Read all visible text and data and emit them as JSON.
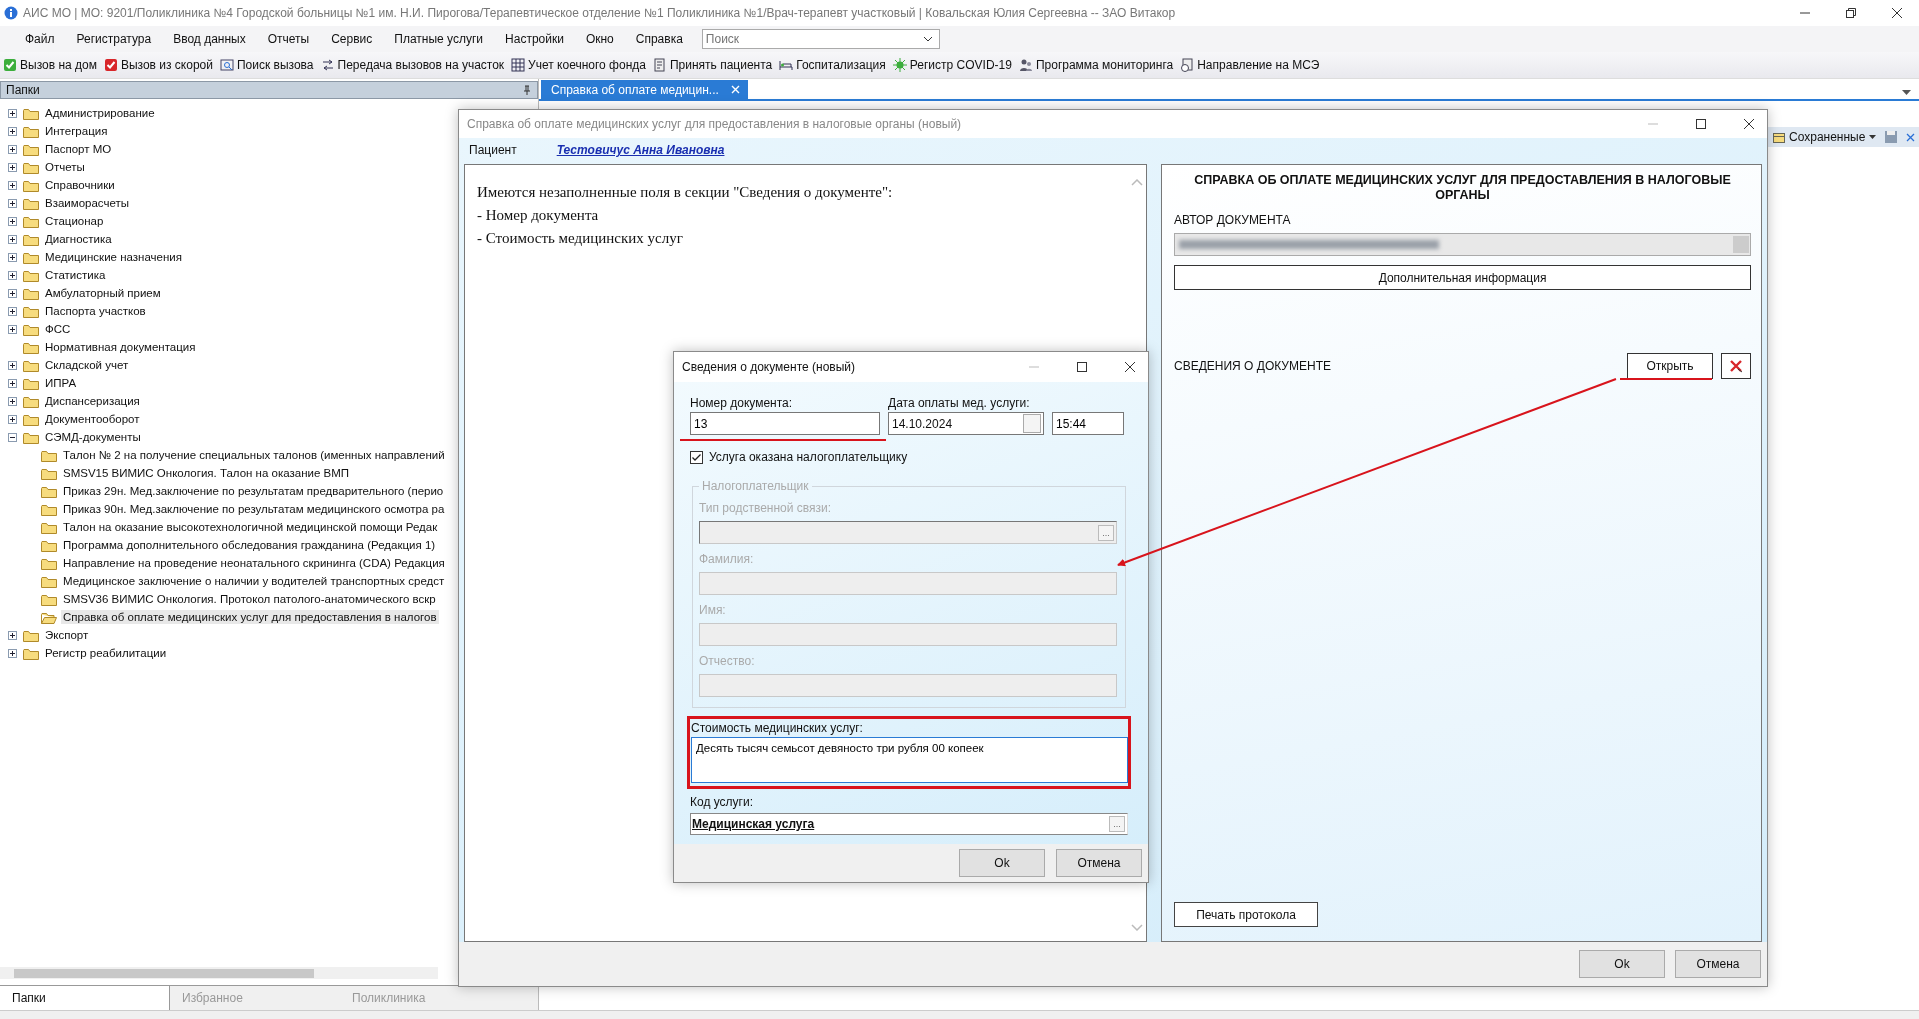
{
  "window": {
    "title": "АИС МО | МО: 9201/Поликлиника №4 Городской больницы №1 им. Н.И. Пирогова/Терапевтическое отделение №1 Поликлиника №1/Врач-терапевт участковый | Ковальская Юлия Сергеевна -- ЗАО Витакор"
  },
  "menu": [
    "Файл",
    "Регистратура",
    "Ввод данных",
    "Отчеты",
    "Сервис",
    "Платные услуги",
    "Настройки",
    "Окно",
    "Справка"
  ],
  "search": {
    "placeholder": "Поиск"
  },
  "toolbar": [
    "Вызов на дом",
    "Вызов из скорой",
    "Поиск вызова",
    "Передача вызовов на участок",
    "Учет коечного фонда",
    "Принять пациента",
    "Госпитализация",
    "Регистр COVID-19",
    "Программа мониторинга",
    "Направление на МСЭ"
  ],
  "folders_panel": {
    "title": "Папки",
    "tree": [
      {
        "label": "Администрирование",
        "expanded": false,
        "selected": false
      },
      {
        "label": "Интеграция",
        "expanded": false,
        "selected": false
      },
      {
        "label": "Паспорт МО",
        "expanded": false,
        "selected": false
      },
      {
        "label": "Отчеты",
        "expanded": false,
        "selected": false
      },
      {
        "label": "Справочники",
        "expanded": false,
        "selected": false
      },
      {
        "label": "Взаиморасчеты",
        "expanded": false,
        "selected": false
      },
      {
        "label": "Стационар",
        "expanded": false,
        "selected": false
      },
      {
        "label": "Диагностика",
        "expanded": false,
        "selected": false
      },
      {
        "label": "Медицинские назначения",
        "expanded": false,
        "selected": false
      },
      {
        "label": "Статистика",
        "expanded": false,
        "selected": false
      },
      {
        "label": "Амбулаторный прием",
        "expanded": false,
        "selected": false
      },
      {
        "label": "Паспорта участков",
        "expanded": false,
        "selected": false
      },
      {
        "label": "ФСС",
        "expanded": false,
        "selected": false
      },
      {
        "label": "Нормативная документация",
        "selected": false
      },
      {
        "label": "Складской учет",
        "expanded": false,
        "selected": false
      },
      {
        "label": "ИПРА",
        "expanded": false,
        "selected": false
      },
      {
        "label": "Диспансеризация",
        "expanded": false,
        "selected": false
      },
      {
        "label": "Документооборот",
        "expanded": false,
        "selected": false
      },
      {
        "label": "СЭМД-документы",
        "expanded": true,
        "selected": false,
        "children": [
          {
            "label": "Талон № 2 на получение специальных талонов (именных направлений",
            "selected": false
          },
          {
            "label": "SMSV15 ВИМИС Онкология. Талон на оказание ВМП",
            "selected": false
          },
          {
            "label": "Приказ 29н. Мед.заключение по результатам предварительного (перио",
            "selected": false
          },
          {
            "label": "Приказ 90н. Мед.заключение по результатам медицинского осмотра ра",
            "selected": false
          },
          {
            "label": "Талон на оказание высокотехнологичной медицинской помощи Редак",
            "selected": false
          },
          {
            "label": "Программа дополнительного обследования гражданина (Редакция 1)",
            "selected": false
          },
          {
            "label": "Направление на проведение неонатального скрининга (CDA) Редакция",
            "selected": false
          },
          {
            "label": "Медицинское заключение о наличии у водителей транспортных средст",
            "selected": false
          },
          {
            "label": "SMSV36 ВИМИС Онкология. Протокол патолого-анатомического вскр",
            "selected": false
          },
          {
            "label": "Справка об оплате медицинских услуг для предоставления в налогов",
            "selected": true
          }
        ]
      },
      {
        "label": "Экспорт",
        "expanded": false,
        "selected": false
      },
      {
        "label": "Регистр реабилитации",
        "expanded": false,
        "selected": false
      }
    ],
    "tabs": [
      {
        "label": "Папки",
        "selected": true
      },
      {
        "label": "Избранное",
        "selected": false
      },
      {
        "label": "Поликлиника",
        "selected": false
      }
    ]
  },
  "document_tabs": [
    {
      "label": "Справка об оплате медицин...",
      "selected": true
    }
  ],
  "saved_toolbar": {
    "label": "Сохраненные"
  },
  "main_dialog": {
    "title": "Справка об оплате медицинских услуг для предоставления в налоговые органы (новый)",
    "patient_label": "Пациент",
    "patient_name": "Тестовичус Анна Ивановна",
    "message": [
      "Имеются незаполненные поля в секции \"Сведения о документе\":",
      "- Номер документа",
      "- Стоимость медицинских услуг"
    ],
    "right_panel": {
      "heading": "СПРАВКА ОБ ОПЛАТЕ МЕДИЦИНСКИХ УСЛУГ ДЛЯ ПРЕДОСТАВЛЕНИЯ В НАЛОГОВЫЕ ОРГАНЫ",
      "author_label": "АВТОР ДОКУМЕНТА",
      "more_info_button": "Дополнительная информация",
      "section_label": "СВЕДЕНИЯ О ДОКУМЕНТЕ",
      "open_button": "Открыть",
      "print_button": "Печать протокола"
    },
    "buttons": [
      "Ok",
      "Отмена"
    ]
  },
  "sub_dialog": {
    "title": "Сведения о документе (новый)",
    "number": {
      "label": "Номер документа:",
      "value": "13"
    },
    "date": {
      "label": "Дата оплаты мед. услуги:",
      "value": "14.10.2024",
      "time": "15:44"
    },
    "taxpayer_checkbox": {
      "label": "Услуга оказана налогоплательщику",
      "checked": true
    },
    "taxpayer_group": {
      "title": "Налогоплательщик",
      "disabled": true,
      "fields": [
        {
          "kind": "lookup",
          "label": "Тип родственной связи:",
          "button": "..."
        },
        {
          "kind": "text",
          "label": "Фамилия:"
        },
        {
          "kind": "text",
          "label": "Имя:"
        },
        {
          "kind": "text",
          "label": "Отчество:"
        }
      ]
    },
    "cost": {
      "label": "Стоимость медицинских услуг:",
      "value": "Десять тысяч семьсот девяносто три рубля 00 копеек"
    },
    "service_code": {
      "label": "Код услуги:",
      "value": "Медицинская услуга",
      "button": "..."
    },
    "buttons": [
      "Ok",
      "Отмена"
    ]
  }
}
